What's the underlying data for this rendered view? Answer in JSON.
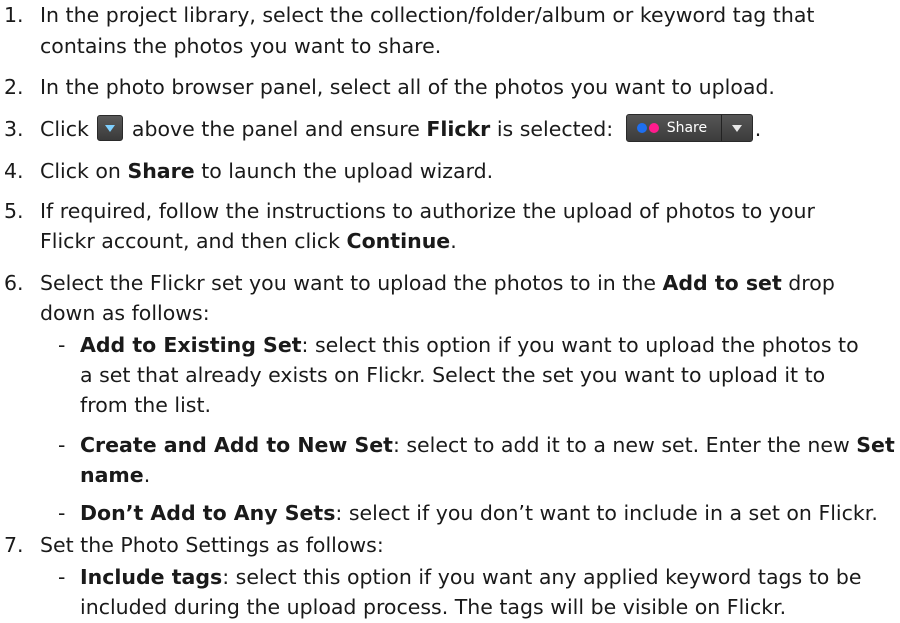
{
  "steps": [
    {
      "num": "1.",
      "lines": [
        "In the project library, select the collection/folder/album or keyword tag that",
        "contains the photos you want to share."
      ]
    },
    {
      "num": "2.",
      "lines": [
        "In the photo browser panel, select all of the photos you want to upload."
      ]
    },
    {
      "num": "3.",
      "pre": "Click",
      "mid": "above the panel and ensure",
      "bold": "Flickr",
      "post": "is selected:",
      "end": "."
    },
    {
      "num": "4.",
      "pre": "Click on",
      "bold": "Share",
      "post": "to launch the upload wizard."
    },
    {
      "num": "5.",
      "line1": "If required, follow the instructions to authorize the upload of photos to your",
      "line2_pre": "Flickr account, and then click",
      "line2_bold": "Continue",
      "line2_post": "."
    },
    {
      "num": "6.",
      "line1_pre": "Select the Flickr set you want to upload the photos to in the",
      "line1_bold": "Add to set",
      "line1_post": "drop",
      "line2": "down as follows:"
    },
    {
      "num": "7.",
      "line1": "Set the Photo Settings as follows:"
    }
  ],
  "sub6": [
    {
      "dash": "-",
      "bold": "Add to Existing Set",
      "rest1": ": select this option if you want to upload the photos to",
      "rest2": "a set that already exists on Flickr. Select the set you want to upload it to",
      "rest3": "from the list."
    },
    {
      "dash": "-",
      "bold": "Create and Add to New Set",
      "rest1": ": select to add it to a new set. Enter the new",
      "bold2": "Set",
      "bold3": "name",
      "rest3": "."
    },
    {
      "dash": "-",
      "bold": "Don’t Add to Any Sets",
      "rest1": ": select if you don’t want to include in a set on Flickr."
    }
  ],
  "sub7": [
    {
      "dash": "-",
      "bold": "Include tags",
      "rest1": ": select this option if you want any applied keyword tags to be",
      "rest2": "included during the upload process. The tags will be visible on Flickr."
    }
  ],
  "share_widget": {
    "label": "Share",
    "dot_colors": [
      "#1e6ff0",
      "#ff1b8d"
    ]
  },
  "icons": {
    "dropdown": "chevron-down-icon",
    "flickr": "flickr-dots-icon"
  }
}
